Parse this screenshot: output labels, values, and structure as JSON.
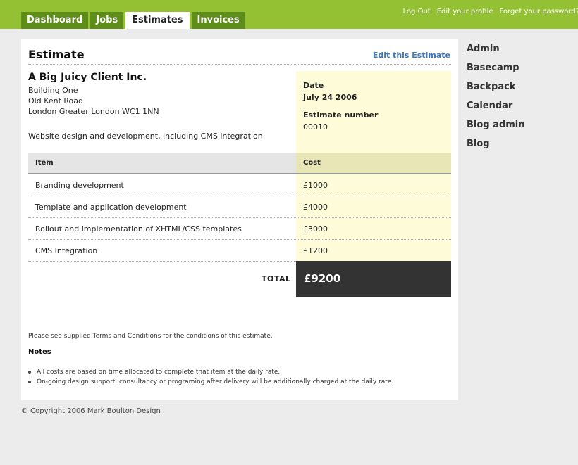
{
  "nav": {
    "tabs": [
      {
        "label": "Dashboard"
      },
      {
        "label": "Jobs"
      },
      {
        "label": "Estimates"
      },
      {
        "label": "Invoices"
      }
    ],
    "top_links": [
      "Log Out",
      "Edit your profile",
      "Forget your password?"
    ]
  },
  "colors": {
    "brand_green": "#94c133",
    "tab_green": "#5e8d1a",
    "highlight_yellow": "#fefcd8",
    "total_bg": "#333333",
    "link_blue": "#3e78b7"
  },
  "estimate": {
    "title": "Estimate",
    "edit_link": "Edit this Estimate",
    "client": {
      "name": "A Big Juicy Client Inc.",
      "address": [
        "Building One",
        "Old Kent Road",
        "London Greater London WC1 1NN"
      ]
    },
    "description": "Website design and development, including CMS integration.",
    "date_label": "Date",
    "date_value": "July 24 2006",
    "number_label": "Estimate number",
    "number_value": "00010",
    "table": {
      "headers": {
        "item": "Item",
        "cost": "Cost"
      },
      "rows": [
        {
          "item": "Branding development",
          "cost": "£1000"
        },
        {
          "item": "Template and application development",
          "cost": "£4000"
        },
        {
          "item": "Rollout and implementation of XHTML/CSS templates",
          "cost": "£3000"
        },
        {
          "item": "CMS Integration",
          "cost": "£1200"
        }
      ]
    },
    "total_label": "TOTAL",
    "total_value": "£9200",
    "terms": "Please see supplied Terms and Conditions for the conditions of this estimate.",
    "notes_heading": "Notes",
    "notes": [
      "All costs are based on time allocated to complete that item at the daily rate.",
      "On-going design support, consultancy or programing after delivery will be additionally charged at the daily rate."
    ]
  },
  "sidebar": {
    "items": [
      "Admin",
      "Basecamp",
      "Backpack",
      "Calendar",
      "Blog admin",
      "Blog"
    ]
  },
  "footer": "© Copyright 2006 Mark Boulton Design"
}
